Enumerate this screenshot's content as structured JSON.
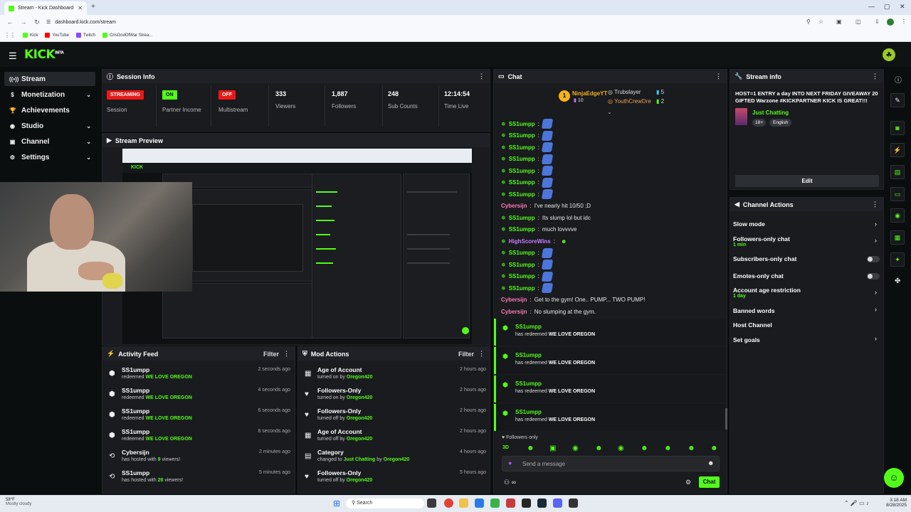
{
  "browser": {
    "tab_title": "Stream - Kick Dashboard",
    "url": "dashboard.kick.com/stream",
    "bookmarks": [
      "Kick",
      "YouTube",
      "Twitch",
      "CrisGodOfWar Strea..."
    ]
  },
  "header": {
    "logo": "KICK",
    "logo_sup": "BETA"
  },
  "sidebar": {
    "items": [
      {
        "label": "Stream",
        "icon": "broadcast-icon",
        "active": true
      },
      {
        "label": "Monetization",
        "icon": "dollar-icon",
        "chevron": true
      },
      {
        "label": "Achievements",
        "icon": "trophy-icon"
      },
      {
        "label": "Studio",
        "icon": "studio-icon",
        "chevron": true
      },
      {
        "label": "Channel",
        "icon": "channel-icon",
        "chevron": true
      },
      {
        "label": "Settings",
        "icon": "gear-icon",
        "chevron": true
      }
    ]
  },
  "session": {
    "title": "Session Info",
    "status": [
      {
        "badge": "STREAMING",
        "label": "Session",
        "color": "#e91916"
      },
      {
        "badge": "ON",
        "label": "Partner Income",
        "color": "#53fc18"
      },
      {
        "badge": "OFF",
        "label": "Multistream",
        "color": "#e91916"
      }
    ],
    "stats": [
      {
        "value": "333",
        "label": "Viewers"
      },
      {
        "value": "1,887",
        "label": "Followers"
      },
      {
        "value": "248",
        "label": "Sub Counts"
      },
      {
        "value": "12:14:54",
        "label": "Time Live"
      }
    ]
  },
  "preview": {
    "title": "Stream Preview"
  },
  "activity": {
    "title": "Activity Feed",
    "filter": "Filter",
    "items": [
      {
        "user": "SS1umpp",
        "pre": "redeemed",
        "hl": "WE LOVE OREGON",
        "time": "2 seconds ago",
        "icon": "gift-icon"
      },
      {
        "user": "SS1umpp",
        "pre": "redeemed",
        "hl": "WE LOVE OREGON",
        "time": "4 seconds ago",
        "icon": "gift-icon"
      },
      {
        "user": "SS1umpp",
        "pre": "redeemed",
        "hl": "WE LOVE OREGON",
        "time": "6 seconds ago",
        "icon": "gift-icon"
      },
      {
        "user": "SS1umpp",
        "pre": "redeemed",
        "hl": "WE LOVE OREGON",
        "time": "8 seconds ago",
        "icon": "gift-icon"
      },
      {
        "user": "Cybersijn",
        "pre": "has hosted with",
        "hl": "9",
        "post": "viewers!",
        "time": "2 minutes ago",
        "icon": "host-icon"
      },
      {
        "user": "SS1umpp",
        "pre": "has hosted with",
        "hl": "26",
        "post": "viewers!",
        "time": "5 minutes ago",
        "icon": "host-icon"
      }
    ]
  },
  "mod": {
    "title": "Mod Actions",
    "filter": "Filter",
    "items": [
      {
        "action": "Age of Account",
        "pre": "turned on by",
        "by": "Oregon420",
        "time": "2 hours ago",
        "icon": "calendar-icon"
      },
      {
        "action": "Followers-Only",
        "pre": "turned on by",
        "by": "Oregon420",
        "time": "2 hours ago",
        "icon": "heart-icon"
      },
      {
        "action": "Followers-Only",
        "pre": "turned off by",
        "by": "Oregon420",
        "time": "2 hours ago",
        "icon": "heart-icon"
      },
      {
        "action": "Age of Account",
        "pre": "turned off by",
        "by": "Oregon420",
        "time": "2 hours ago",
        "icon": "calendar-icon"
      },
      {
        "action": "Category",
        "pre": "changed to",
        "mid": "Just Chatting",
        "midby": "by",
        "by": "Oregon420",
        "time": "4 hours ago",
        "icon": "category-icon"
      },
      {
        "action": "Followers-Only",
        "pre": "turned off by",
        "by": "Oregon420",
        "time": "5 hours ago",
        "icon": "heart-icon"
      }
    ]
  },
  "chat": {
    "title": "Chat",
    "leaders": [
      {
        "rank": "1",
        "name": "NinjaEdgeYT",
        "count": "10"
      },
      {
        "name": "Trubslayer",
        "count": "5"
      },
      {
        "name": "YouthCrewDre",
        "count": "2"
      }
    ],
    "messages": [
      {
        "user": "SS1umpp",
        "color": "#53fc18",
        "emote": true
      },
      {
        "user": "SS1umpp",
        "color": "#53fc18",
        "emote": true
      },
      {
        "user": "SS1umpp",
        "color": "#53fc18",
        "emote": true
      },
      {
        "user": "SS1umpp",
        "color": "#53fc18",
        "emote": true
      },
      {
        "user": "SS1umpp",
        "color": "#53fc18",
        "emote": true
      },
      {
        "user": "SS1umpp",
        "color": "#53fc18",
        "emote": true
      },
      {
        "user": "SS1umpp",
        "color": "#53fc18",
        "emote": true
      },
      {
        "user": "Cybersijn",
        "color": "#ff7ab3",
        "text": "I've nearly hit 10/50 ;D"
      },
      {
        "user": "SS1umpp",
        "color": "#53fc18",
        "text": "Its slump lol but idc"
      },
      {
        "user": "SS1umpp",
        "color": "#53fc18",
        "text": "much lovvvve"
      },
      {
        "user": "HighScoreWins",
        "color": "#c77dff",
        "text": ""
      },
      {
        "user": "SS1umpp",
        "color": "#53fc18",
        "emote": true
      },
      {
        "user": "SS1umpp",
        "color": "#53fc18",
        "emote": true
      },
      {
        "user": "SS1umpp",
        "color": "#53fc18",
        "emote": true
      },
      {
        "user": "SS1umpp",
        "color": "#53fc18",
        "emote": true
      },
      {
        "user": "Cybersijn",
        "color": "#ff7ab3",
        "text": "Get to the gym! One.. PUMP... TWO PUMP!"
      },
      {
        "user": "Cybersijn",
        "color": "#ff7ab3",
        "text": "No slumping at the gym."
      }
    ],
    "redeems": [
      {
        "user": "SS1umpp",
        "pre": "has redeemed",
        "reward": "WE LOVE OREGON"
      },
      {
        "user": "SS1umpp",
        "pre": "has redeemed",
        "reward": "WE LOVE OREGON"
      },
      {
        "user": "SS1umpp",
        "pre": "has redeemed",
        "reward": "WE LOVE OREGON"
      },
      {
        "user": "SS1umpp",
        "pre": "has redeemed",
        "reward": "WE LOVE OREGON"
      }
    ],
    "followers_only": "Followers only",
    "placeholder": "Send a message",
    "send": "Chat"
  },
  "stream_info": {
    "title": "Stream info",
    "stream_title": "HOST=1 ENTRY a day INTO NEXT FRIDAY GIVEAWAY 20 GIFTED Warzone #KICKPARTNER KICK IS GREAT!!!",
    "category": "Just Chatting",
    "tags": [
      "18+",
      "English"
    ],
    "edit": "Edit"
  },
  "channel_actions": {
    "title": "Channel Actions",
    "items": [
      {
        "label": "Slow mode",
        "kind": "arrow"
      },
      {
        "label": "Followers-only chat",
        "sub": "1 min",
        "kind": "arrow"
      },
      {
        "label": "Subscribers-only chat",
        "kind": "toggle"
      },
      {
        "label": "Emotes-only chat",
        "kind": "toggle"
      },
      {
        "label": "Account age restriction",
        "sub": "1 day",
        "kind": "arrow"
      },
      {
        "label": "Banned words",
        "kind": "arrow"
      },
      {
        "label": "Host Channel",
        "kind": "none"
      },
      {
        "label": "Set goals",
        "kind": "arrow"
      }
    ]
  },
  "taskbar": {
    "weather_temp": "58°F",
    "weather_desc": "Mostly cloudy",
    "search": "Search",
    "time": "3:18 AM",
    "date": "8/28/2025"
  }
}
